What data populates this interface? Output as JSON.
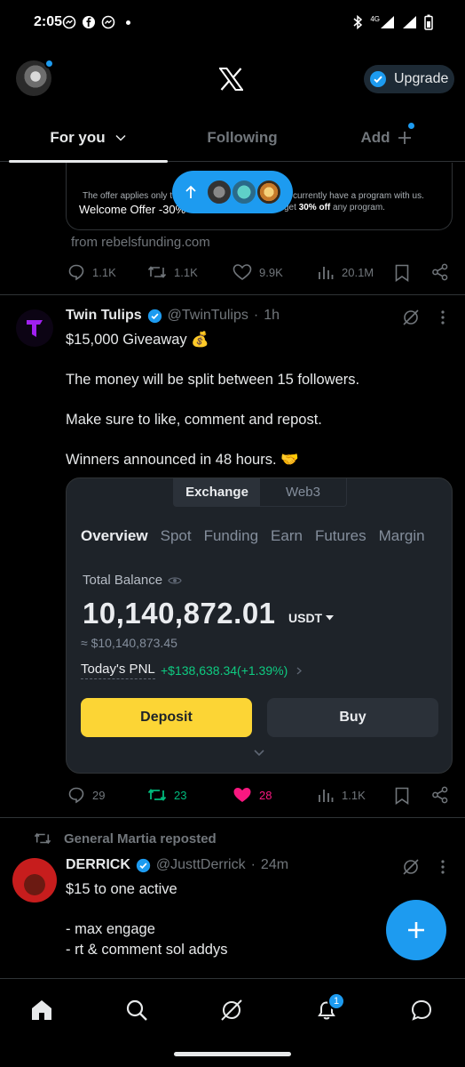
{
  "status_bar": {
    "time": "2:05",
    "network": "4G"
  },
  "header": {
    "upgrade_label": "Upgrade"
  },
  "tabs": [
    {
      "label": "For you"
    },
    {
      "label": "Following"
    },
    {
      "label": "Add"
    }
  ],
  "promo_card": {
    "small_text": "The offer applies only t",
    "small_text_right": "currently have a program with us.",
    "welcome": "Welcome Offer -30%",
    "get_prefix": "get",
    "get_bold": "30% off",
    "get_suffix": "any program.",
    "source": "from rebelsfunding.com"
  },
  "tweet0_actions": {
    "replies": "1.1K",
    "reposts": "1.1K",
    "likes": "9.9K",
    "views": "20.1M"
  },
  "tweet1": {
    "name": "Twin Tulips",
    "handle": "@TwinTulips",
    "time": "1h",
    "line1": "$15,000 Giveaway 💰",
    "line2": "The money will be split between 15 followers.",
    "line3": "Make sure to like, comment and repost.",
    "line4": "Winners announced in 48 hours. 🤝",
    "media": {
      "seg_on": "Exchange",
      "seg_off": "Web3",
      "nav": [
        "Overview",
        "Spot",
        "Funding",
        "Earn",
        "Futures",
        "Margin"
      ],
      "balance_label": "Total Balance",
      "balance": "10,140,872.01",
      "currency": "USDT",
      "usd": "≈ $10,140,873.45",
      "pnl_label": "Today's PNL",
      "pnl_value": "+$138,638.34(+1.39%)",
      "deposit": "Deposit",
      "buy": "Buy"
    },
    "actions": {
      "replies": "29",
      "reposts": "23",
      "likes": "28",
      "views": "1.1K"
    }
  },
  "tweet2": {
    "reposted_by": "General Martia reposted",
    "name": "DERRICK",
    "handle": "@JusttDerrick",
    "time": "24m",
    "line1": "$15 to one active",
    "line2": "- max engage",
    "line3": "- rt & comment sol addys"
  },
  "bottom_nav": {
    "notif_count": "1"
  },
  "colors": {
    "accent": "#1d9bf0",
    "like": "#f91880",
    "repost": "#00ba7c",
    "binance_yellow": "#fcd535"
  }
}
